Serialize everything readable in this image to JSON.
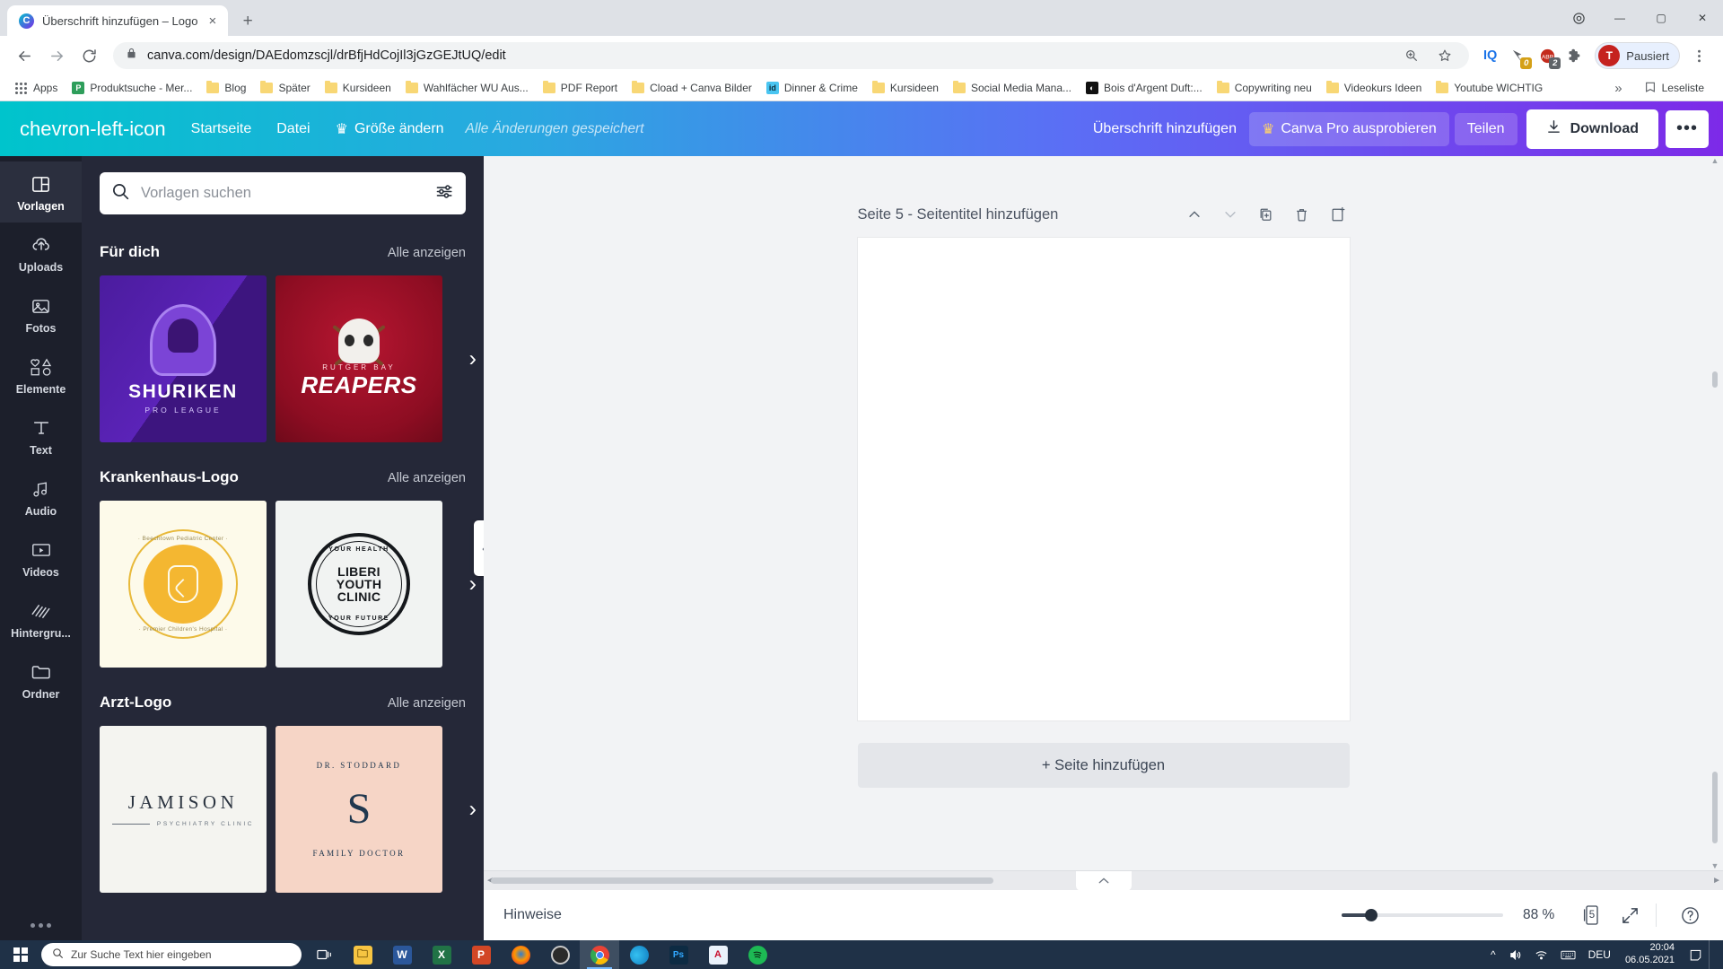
{
  "browser": {
    "tab": {
      "title": "Überschrift hinzufügen – Logo",
      "favicon": "canva-icon",
      "close": "×"
    },
    "newtab_label": "+",
    "window_controls": {
      "minimize": "—",
      "maximize": "▢",
      "close": "✕"
    },
    "nav": {
      "back": "←",
      "forward": "→",
      "reload": "⟳"
    },
    "omnibox": {
      "url": "canva.com/design/DAEdomzscjl/drBfjHdCojIl3jGzGEJtUQ/edit",
      "lock_icon": "lock-icon",
      "zoom_icon": "zoom-indicator-icon",
      "star_icon": "bookmark-star-icon"
    },
    "extensions": [
      {
        "name": "iq-extension",
        "label": "IQ",
        "badge": ""
      },
      {
        "name": "pocket-extension",
        "label": "",
        "badge": "0",
        "badge_color": "#d4a017"
      },
      {
        "name": "adblock-extension",
        "label": "ABP",
        "badge": "2",
        "badge_color": "#5f6368"
      },
      {
        "name": "puzzle-extensions-icon",
        "label": "",
        "badge": ""
      }
    ],
    "profile": {
      "initial": "T",
      "label": "Pausiert"
    },
    "menu_icon": "three-dots-vertical-icon",
    "bookmarks": [
      {
        "label": "Apps",
        "icon": "apps-grid-icon"
      },
      {
        "label": "Produktsuche - Mer...",
        "icon": "site-icon",
        "color": "#2e9e5b"
      },
      {
        "label": "Blog",
        "icon": "folder-icon"
      },
      {
        "label": "Später",
        "icon": "folder-icon"
      },
      {
        "label": "Kursideen",
        "icon": "folder-icon"
      },
      {
        "label": "Wahlfächer WU Aus...",
        "icon": "folder-icon"
      },
      {
        "label": "PDF Report",
        "icon": "folder-icon"
      },
      {
        "label": "Cload + Canva Bilder",
        "icon": "folder-icon"
      },
      {
        "label": "Dinner & Crime",
        "icon": "indesign-icon",
        "color": "#49c5f1",
        "glyph": "id"
      },
      {
        "label": "Kursideen",
        "icon": "folder-icon"
      },
      {
        "label": "Social Media Mana...",
        "icon": "folder-icon"
      },
      {
        "label": "Bois d'Argent Duft:...",
        "icon": "dior-icon",
        "color": "#111111",
        "glyph": "◐"
      },
      {
        "label": "Copywriting neu",
        "icon": "folder-icon"
      },
      {
        "label": "Videokurs Ideen",
        "icon": "folder-icon"
      },
      {
        "label": "Youtube WICHTIG",
        "icon": "folder-icon"
      }
    ],
    "bookmarks_overflow": "»",
    "reading_list": {
      "label": "Leseliste",
      "icon": "reading-list-icon"
    }
  },
  "canva": {
    "topbar": {
      "back_icon": "chevron-left-icon",
      "home": "Startseite",
      "file": "Datei",
      "resize": "Größe ändern",
      "resize_icon": "crown-icon",
      "saved_status": "Alle Änderungen gespeichert",
      "add_heading": "Überschrift hinzufügen",
      "pro": "Canva Pro ausprobieren",
      "pro_icon": "crown-icon",
      "share": "Teilen",
      "download": "Download",
      "download_icon": "download-arrow-icon",
      "more": "•••"
    },
    "rail": [
      {
        "label": "Vorlagen",
        "icon": "templates-icon",
        "active": true
      },
      {
        "label": "Uploads",
        "icon": "upload-cloud-icon",
        "active": false
      },
      {
        "label": "Fotos",
        "icon": "photo-icon",
        "active": false
      },
      {
        "label": "Elemente",
        "icon": "shapes-icon",
        "active": false
      },
      {
        "label": "Text",
        "icon": "text-t-icon",
        "active": false
      },
      {
        "label": "Audio",
        "icon": "music-note-icon",
        "active": false
      },
      {
        "label": "Videos",
        "icon": "video-play-icon",
        "active": false
      },
      {
        "label": "Hintergru...",
        "icon": "background-pattern-icon",
        "active": false
      },
      {
        "label": "Ordner",
        "icon": "folder-icon",
        "active": false
      }
    ],
    "rail_more": "more-dots-icon",
    "panel": {
      "search_placeholder": "Vorlagen suchen",
      "search_value": "",
      "search_icon": "search-icon",
      "filter_icon": "filter-sliders-icon",
      "collapse_icon": "chevron-left-icon",
      "sections": [
        {
          "title": "Für dich",
          "all_label": "Alle anzeigen",
          "arrow_icon": "chevron-right-icon",
          "cards": [
            {
              "name": "shuriken-pro-league",
              "title": "SHURIKEN",
              "subtitle": "PRO LEAGUE"
            },
            {
              "name": "rutger-bay-reapers",
              "title": "REAPERS",
              "subtitle": "RUTGER BAY"
            }
          ]
        },
        {
          "title": "Krankenhaus-Logo",
          "all_label": "Alle anzeigen",
          "arrow_icon": "chevron-right-icon",
          "cards": [
            {
              "name": "beechtown-pediatric",
              "top": "· Beechtown Pediatric Center ·",
              "bottom": "· Premier Children's Hospital ·"
            },
            {
              "name": "liberi-youth-clinic",
              "top": "YOUR HEALTH",
              "title": "LIBERI YOUTH CLINIC",
              "bottom": "YOUR FUTURE"
            }
          ]
        },
        {
          "title": "Arzt-Logo",
          "all_label": "Alle anzeigen",
          "arrow_icon": "chevron-right-icon",
          "cards": [
            {
              "name": "jamison-psychiatry",
              "title": "JAMISON",
              "subtitle": "PSYCHIATRY CLINIC"
            },
            {
              "name": "dr-stoddard-family-doctor",
              "top": "DR. STODDARD",
              "title": "S",
              "bottom": "FAMILY DOCTOR"
            }
          ]
        }
      ]
    },
    "editor": {
      "page_label": "Seite 5 - Seitentitel hinzufügen",
      "tools": [
        {
          "name": "move-page-up-button",
          "icon": "chevron-up-icon",
          "dim": false
        },
        {
          "name": "move-page-down-button",
          "icon": "chevron-down-icon",
          "dim": true
        },
        {
          "name": "duplicate-page-button",
          "icon": "duplicate-icon",
          "dim": false
        },
        {
          "name": "delete-page-button",
          "icon": "trash-icon",
          "dim": false
        },
        {
          "name": "add-page-after-button",
          "icon": "add-page-icon",
          "dim": false
        }
      ],
      "add_page": "+ Seite hinzufügen",
      "hbar_collapse_icon": "chevron-up-icon"
    },
    "statusbar": {
      "notes": "Hinweise",
      "zoom_value": "88 %",
      "zoom_slider_percent": 17,
      "page_count": "5",
      "page_count_icon": "page-stack-icon",
      "fullscreen_icon": "expand-arrows-icon",
      "help_icon": "question-mark-icon"
    }
  },
  "taskbar": {
    "start_icon": "windows-logo-icon",
    "search_placeholder": "Zur Suche Text hier eingeben",
    "search_icon": "search-icon",
    "taskview_icon": "task-view-icon",
    "apps": [
      {
        "name": "file-explorer",
        "glyph": "🗂",
        "color": "#f9c851"
      },
      {
        "name": "word",
        "glyph": "W",
        "color": "#2b579a"
      },
      {
        "name": "excel",
        "glyph": "X",
        "color": "#217346"
      },
      {
        "name": "powerpoint",
        "glyph": "P",
        "color": "#d24726"
      },
      {
        "name": "firefox",
        "glyph": "",
        "color": "#e66000"
      },
      {
        "name": "opera-gx",
        "glyph": "",
        "color": "#3a3a3a"
      },
      {
        "name": "chrome",
        "glyph": "",
        "color": "#ffffff",
        "active": true
      },
      {
        "name": "edge",
        "glyph": "",
        "color": "#0f7bbf"
      },
      {
        "name": "photoshop",
        "glyph": "Ps",
        "color": "#1b3a5c"
      },
      {
        "name": "acrobat",
        "glyph": "A",
        "color": "#e5effa"
      },
      {
        "name": "spotify",
        "glyph": "",
        "color": "#1db954"
      }
    ],
    "tray": {
      "chevron": "^",
      "volume_icon": "speaker-icon",
      "network_icon": "wifi-icon",
      "keyboard_icon": "keyboard-icon",
      "language": "DEU",
      "time": "20:04",
      "date": "06.05.2021",
      "action_center_icon": "notification-icon"
    }
  }
}
